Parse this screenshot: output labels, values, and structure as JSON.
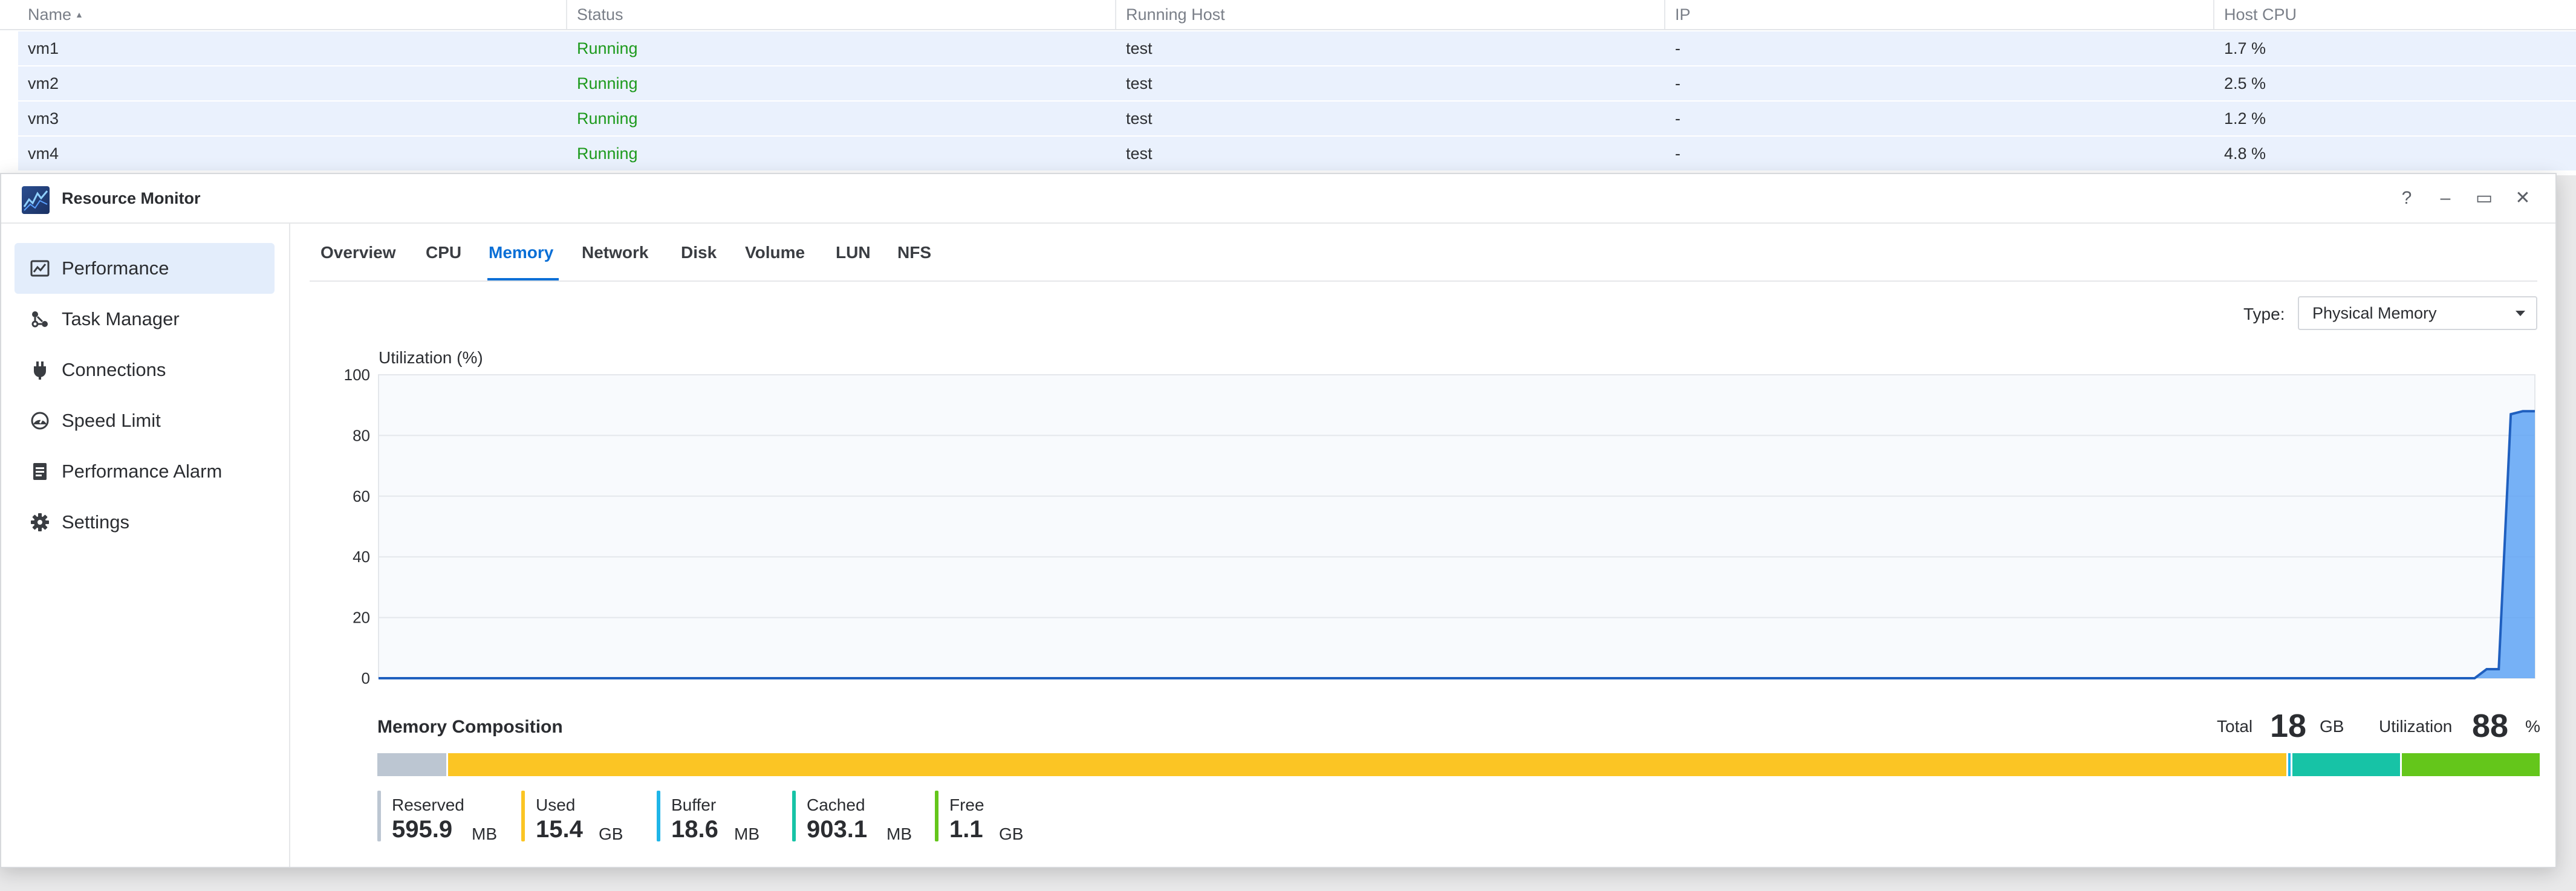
{
  "vm_table": {
    "columns": [
      "Name",
      "Status",
      "Running Host",
      "IP",
      "Host CPU"
    ],
    "rows": [
      {
        "name": "vm1",
        "status": "Running",
        "host": "test",
        "ip": "-",
        "cpu": "1.7 %"
      },
      {
        "name": "vm2",
        "status": "Running",
        "host": "test",
        "ip": "-",
        "cpu": "2.5 %"
      },
      {
        "name": "vm3",
        "status": "Running",
        "host": "test",
        "ip": "-",
        "cpu": "1.2 %"
      },
      {
        "name": "vm4",
        "status": "Running",
        "host": "test",
        "ip": "-",
        "cpu": "4.8 %"
      }
    ]
  },
  "window": {
    "title": "Resource Monitor",
    "controls": {
      "help": "?",
      "minimize": "–",
      "maximize": "▭",
      "close": "✕"
    }
  },
  "sidebar": {
    "items": [
      {
        "label": "Performance",
        "icon": "performance-chart-icon",
        "active": true
      },
      {
        "label": "Task Manager",
        "icon": "task-manager-icon",
        "active": false
      },
      {
        "label": "Connections",
        "icon": "plug-icon",
        "active": false
      },
      {
        "label": "Speed Limit",
        "icon": "speedometer-icon",
        "active": false
      },
      {
        "label": "Performance Alarm",
        "icon": "alarm-clipboard-icon",
        "active": false
      },
      {
        "label": "Settings",
        "icon": "gear-icon",
        "active": false
      }
    ]
  },
  "tabs": [
    {
      "label": "Overview"
    },
    {
      "label": "CPU"
    },
    {
      "label": "Memory",
      "active": true
    },
    {
      "label": "Network"
    },
    {
      "label": "Disk"
    },
    {
      "label": "Volume"
    },
    {
      "label": "LUN"
    },
    {
      "label": "NFS"
    }
  ],
  "type_select": {
    "label": "Type:",
    "value": "Physical Memory"
  },
  "chart_data": {
    "type": "area",
    "title": "",
    "ylabel": "Utilization (%)",
    "xlabel": "",
    "ylim": [
      0,
      100
    ],
    "yticks": [
      0,
      20,
      40,
      60,
      80,
      100
    ],
    "grid": true,
    "color": "#5fa3f5",
    "x_count": 180,
    "series": [
      {
        "values": [
          {
            "i": 0,
            "y": 0
          },
          {
            "i": 174,
            "y": 0
          },
          {
            "i": 175,
            "y": 3
          },
          {
            "i": 176,
            "y": 3
          },
          {
            "i": 177,
            "y": 87
          },
          {
            "i": 178,
            "y": 88
          },
          {
            "i": 179,
            "y": 88
          }
        ]
      }
    ]
  },
  "composition": {
    "title": "Memory Composition",
    "total_label": "Total",
    "total_value": "18",
    "total_unit": "GB",
    "util_label": "Utilization",
    "util_value": "88",
    "util_unit": "%",
    "segments": [
      {
        "name": "Reserved",
        "value": "595.9",
        "unit": "MB",
        "color": "#bcc6d2",
        "share": 3.2
      },
      {
        "name": "Used",
        "value": "15.4",
        "unit": "GB",
        "color": "#fbc524",
        "share": 85.3
      },
      {
        "name": "Buffer",
        "value": "18.6",
        "unit": "MB",
        "color": "#1fb5e8",
        "share": 0.1
      },
      {
        "name": "Cached",
        "value": "903.1",
        "unit": "MB",
        "color": "#17c3a6",
        "share": 5.0
      },
      {
        "name": "Free",
        "value": "1.1",
        "unit": "GB",
        "color": "#64c61b",
        "share": 6.4
      }
    ]
  }
}
